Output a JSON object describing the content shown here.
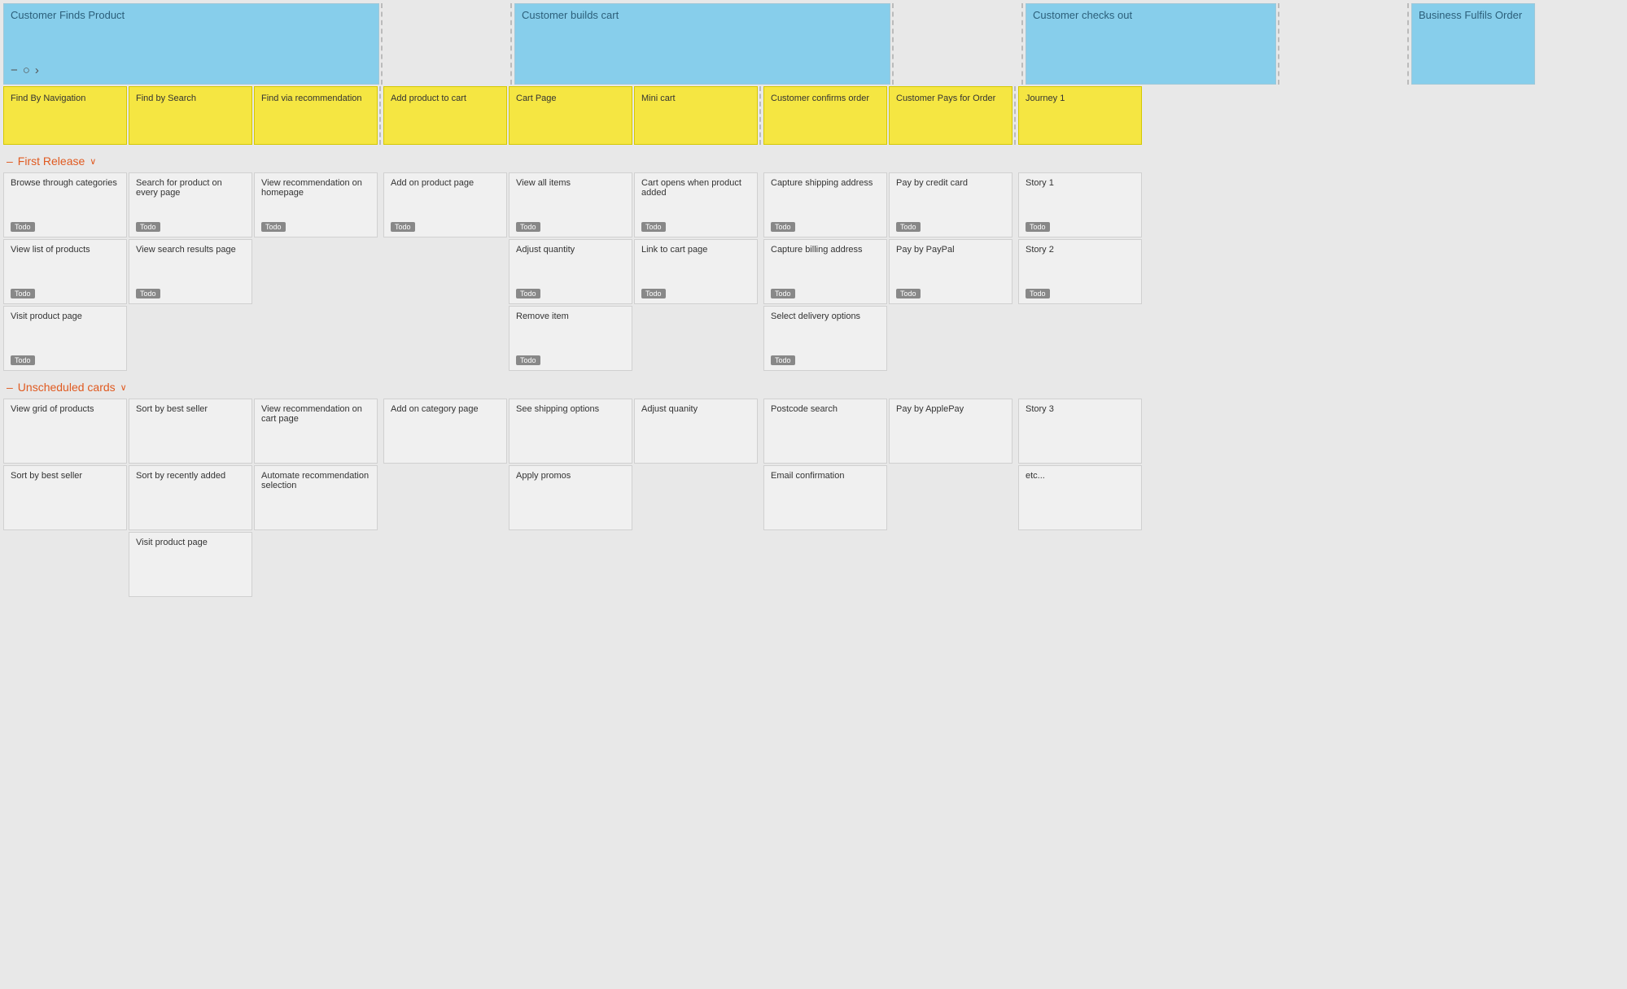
{
  "epics": [
    {
      "id": "e1",
      "title": "Customer Finds Product",
      "hasIcons": true,
      "span": 3
    },
    {
      "id": "e2",
      "title": "",
      "empty": true,
      "span": 1
    },
    {
      "id": "e3",
      "title": "Customer builds cart",
      "hasIcons": false,
      "span": 3
    },
    {
      "id": "e4",
      "title": "",
      "empty": true,
      "span": 1
    },
    {
      "id": "e5",
      "title": "Customer checks out",
      "hasIcons": false,
      "span": 2
    },
    {
      "id": "e6",
      "title": "",
      "empty": true,
      "span": 1
    },
    {
      "id": "e7",
      "title": "Business Fulfils Order",
      "hasIcons": false,
      "span": 1
    }
  ],
  "stories": [
    {
      "title": "Find By Navigation",
      "yellow": true
    },
    {
      "title": "Find by Search",
      "yellow": true
    },
    {
      "title": "Find via recommendation",
      "yellow": true
    },
    {
      "title": "Add product to cart",
      "yellow": true
    },
    {
      "title": "Cart Page",
      "yellow": true
    },
    {
      "title": "Mini cart",
      "yellow": true
    },
    {
      "title": "Customer confirms order",
      "yellow": true
    },
    {
      "title": "Customer Pays for Order",
      "yellow": true
    },
    {
      "title": "Journey 1",
      "yellow": true
    }
  ],
  "sections": [
    {
      "id": "first-release",
      "label": "First Release",
      "columns": [
        {
          "cards": [
            {
              "title": "Browse through categories",
              "todo": true
            },
            {
              "title": "View list of products",
              "todo": true
            },
            {
              "title": "Visit product page",
              "todo": true
            }
          ]
        },
        {
          "cards": [
            {
              "title": "Search for product on every page",
              "todo": true
            },
            {
              "title": "View search results page",
              "todo": true
            }
          ]
        },
        {
          "cards": [
            {
              "title": "View recommendation on homepage",
              "todo": true
            }
          ]
        },
        {
          "cards": [
            {
              "title": "Add on product page",
              "todo": true
            }
          ]
        },
        {
          "cards": [
            {
              "title": "View all items",
              "todo": true
            },
            {
              "title": "Adjust quantity",
              "todo": true
            },
            {
              "title": "Remove item",
              "todo": true
            }
          ]
        },
        {
          "cards": [
            {
              "title": "Cart opens when product added",
              "todo": true
            },
            {
              "title": "Link to cart page",
              "todo": true
            }
          ]
        },
        {
          "cards": [
            {
              "title": "Capture shipping address",
              "todo": true
            },
            {
              "title": "Capture billing address",
              "todo": true
            },
            {
              "title": "Select delivery options",
              "todo": true
            }
          ]
        },
        {
          "cards": [
            {
              "title": "Pay by credit card",
              "todo": true
            },
            {
              "title": "Pay by PayPal",
              "todo": true
            }
          ]
        },
        {
          "cards": [
            {
              "title": "Story 1",
              "todo": true
            },
            {
              "title": "Story 2",
              "todo": true
            }
          ]
        }
      ]
    },
    {
      "id": "unscheduled",
      "label": "Unscheduled cards",
      "columns": [
        {
          "cards": [
            {
              "title": "View grid of products",
              "todo": false
            },
            {
              "title": "Sort by best seller",
              "todo": false
            }
          ]
        },
        {
          "cards": [
            {
              "title": "Sort by best seller",
              "todo": false
            },
            {
              "title": "Sort by recently added",
              "todo": false
            },
            {
              "title": "Visit product page",
              "todo": false
            }
          ]
        },
        {
          "cards": [
            {
              "title": "View recommendation on cart page",
              "todo": false
            },
            {
              "title": "Automate recommendation selection",
              "todo": false
            }
          ]
        },
        {
          "cards": [
            {
              "title": "Add on category page",
              "todo": false
            }
          ]
        },
        {
          "cards": [
            {
              "title": "See shipping options",
              "todo": false
            },
            {
              "title": "Apply promos",
              "todo": false
            }
          ]
        },
        {
          "cards": [
            {
              "title": "Adjust quanity",
              "todo": false
            }
          ]
        },
        {
          "cards": [
            {
              "title": "Postcode search",
              "todo": false
            },
            {
              "title": "Email confirmation",
              "todo": false
            }
          ]
        },
        {
          "cards": [
            {
              "title": "Pay by ApplePay",
              "todo": false
            }
          ]
        },
        {
          "cards": [
            {
              "title": "Story 3",
              "todo": false
            },
            {
              "title": "etc...",
              "todo": false
            }
          ]
        }
      ]
    }
  ],
  "icons": {
    "minus": "−",
    "circle": "○",
    "arrow": "›",
    "chevron_down": "∨"
  }
}
